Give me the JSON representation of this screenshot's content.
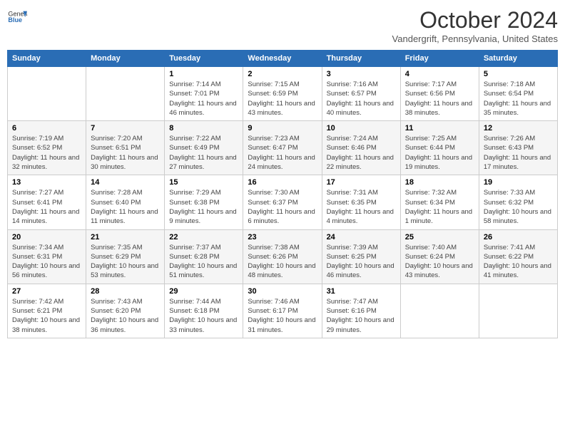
{
  "header": {
    "logo_general": "General",
    "logo_blue": "Blue",
    "title": "October 2024",
    "location": "Vandergrift, Pennsylvania, United States"
  },
  "weekdays": [
    "Sunday",
    "Monday",
    "Tuesday",
    "Wednesday",
    "Thursday",
    "Friday",
    "Saturday"
  ],
  "weeks": [
    [
      {
        "day": null,
        "info": ""
      },
      {
        "day": null,
        "info": ""
      },
      {
        "day": "1",
        "info": "Sunrise: 7:14 AM\nSunset: 7:01 PM\nDaylight: 11 hours and 46 minutes."
      },
      {
        "day": "2",
        "info": "Sunrise: 7:15 AM\nSunset: 6:59 PM\nDaylight: 11 hours and 43 minutes."
      },
      {
        "day": "3",
        "info": "Sunrise: 7:16 AM\nSunset: 6:57 PM\nDaylight: 11 hours and 40 minutes."
      },
      {
        "day": "4",
        "info": "Sunrise: 7:17 AM\nSunset: 6:56 PM\nDaylight: 11 hours and 38 minutes."
      },
      {
        "day": "5",
        "info": "Sunrise: 7:18 AM\nSunset: 6:54 PM\nDaylight: 11 hours and 35 minutes."
      }
    ],
    [
      {
        "day": "6",
        "info": "Sunrise: 7:19 AM\nSunset: 6:52 PM\nDaylight: 11 hours and 32 minutes."
      },
      {
        "day": "7",
        "info": "Sunrise: 7:20 AM\nSunset: 6:51 PM\nDaylight: 11 hours and 30 minutes."
      },
      {
        "day": "8",
        "info": "Sunrise: 7:22 AM\nSunset: 6:49 PM\nDaylight: 11 hours and 27 minutes."
      },
      {
        "day": "9",
        "info": "Sunrise: 7:23 AM\nSunset: 6:47 PM\nDaylight: 11 hours and 24 minutes."
      },
      {
        "day": "10",
        "info": "Sunrise: 7:24 AM\nSunset: 6:46 PM\nDaylight: 11 hours and 22 minutes."
      },
      {
        "day": "11",
        "info": "Sunrise: 7:25 AM\nSunset: 6:44 PM\nDaylight: 11 hours and 19 minutes."
      },
      {
        "day": "12",
        "info": "Sunrise: 7:26 AM\nSunset: 6:43 PM\nDaylight: 11 hours and 17 minutes."
      }
    ],
    [
      {
        "day": "13",
        "info": "Sunrise: 7:27 AM\nSunset: 6:41 PM\nDaylight: 11 hours and 14 minutes."
      },
      {
        "day": "14",
        "info": "Sunrise: 7:28 AM\nSunset: 6:40 PM\nDaylight: 11 hours and 11 minutes."
      },
      {
        "day": "15",
        "info": "Sunrise: 7:29 AM\nSunset: 6:38 PM\nDaylight: 11 hours and 9 minutes."
      },
      {
        "day": "16",
        "info": "Sunrise: 7:30 AM\nSunset: 6:37 PM\nDaylight: 11 hours and 6 minutes."
      },
      {
        "day": "17",
        "info": "Sunrise: 7:31 AM\nSunset: 6:35 PM\nDaylight: 11 hours and 4 minutes."
      },
      {
        "day": "18",
        "info": "Sunrise: 7:32 AM\nSunset: 6:34 PM\nDaylight: 11 hours and 1 minute."
      },
      {
        "day": "19",
        "info": "Sunrise: 7:33 AM\nSunset: 6:32 PM\nDaylight: 10 hours and 58 minutes."
      }
    ],
    [
      {
        "day": "20",
        "info": "Sunrise: 7:34 AM\nSunset: 6:31 PM\nDaylight: 10 hours and 56 minutes."
      },
      {
        "day": "21",
        "info": "Sunrise: 7:35 AM\nSunset: 6:29 PM\nDaylight: 10 hours and 53 minutes."
      },
      {
        "day": "22",
        "info": "Sunrise: 7:37 AM\nSunset: 6:28 PM\nDaylight: 10 hours and 51 minutes."
      },
      {
        "day": "23",
        "info": "Sunrise: 7:38 AM\nSunset: 6:26 PM\nDaylight: 10 hours and 48 minutes."
      },
      {
        "day": "24",
        "info": "Sunrise: 7:39 AM\nSunset: 6:25 PM\nDaylight: 10 hours and 46 minutes."
      },
      {
        "day": "25",
        "info": "Sunrise: 7:40 AM\nSunset: 6:24 PM\nDaylight: 10 hours and 43 minutes."
      },
      {
        "day": "26",
        "info": "Sunrise: 7:41 AM\nSunset: 6:22 PM\nDaylight: 10 hours and 41 minutes."
      }
    ],
    [
      {
        "day": "27",
        "info": "Sunrise: 7:42 AM\nSunset: 6:21 PM\nDaylight: 10 hours and 38 minutes."
      },
      {
        "day": "28",
        "info": "Sunrise: 7:43 AM\nSunset: 6:20 PM\nDaylight: 10 hours and 36 minutes."
      },
      {
        "day": "29",
        "info": "Sunrise: 7:44 AM\nSunset: 6:18 PM\nDaylight: 10 hours and 33 minutes."
      },
      {
        "day": "30",
        "info": "Sunrise: 7:46 AM\nSunset: 6:17 PM\nDaylight: 10 hours and 31 minutes."
      },
      {
        "day": "31",
        "info": "Sunrise: 7:47 AM\nSunset: 6:16 PM\nDaylight: 10 hours and 29 minutes."
      },
      {
        "day": null,
        "info": ""
      },
      {
        "day": null,
        "info": ""
      }
    ]
  ]
}
